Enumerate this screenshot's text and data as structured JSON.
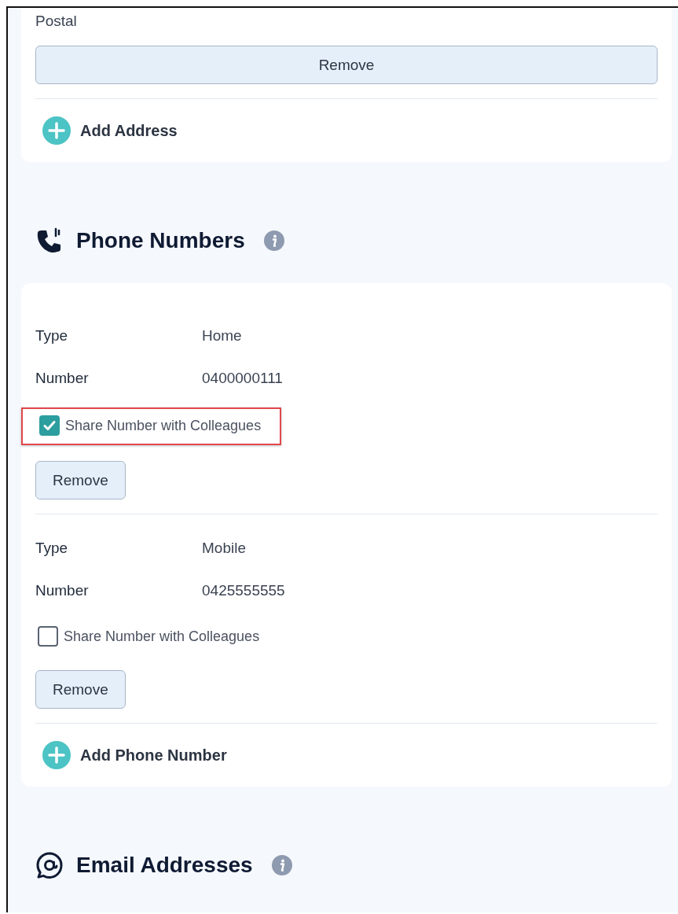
{
  "address_card": {
    "value": "Postal",
    "remove_button": "Remove",
    "add_button": "Add Address"
  },
  "phone_section": {
    "title": "Phone Numbers",
    "entries": [
      {
        "type_label": "Type",
        "type_value": "Home",
        "number_label": "Number",
        "number_value": "0400000111",
        "share_label": "Share Number with Colleagues",
        "checked": true,
        "highlighted": true,
        "remove_button": "Remove"
      },
      {
        "type_label": "Type",
        "type_value": "Mobile",
        "number_label": "Number",
        "number_value": "0425555555",
        "share_label": "Share Number with Colleagues",
        "checked": false,
        "highlighted": false,
        "remove_button": "Remove"
      }
    ],
    "add_button": "Add Phone Number"
  },
  "email_section": {
    "title": "Email Addresses"
  }
}
